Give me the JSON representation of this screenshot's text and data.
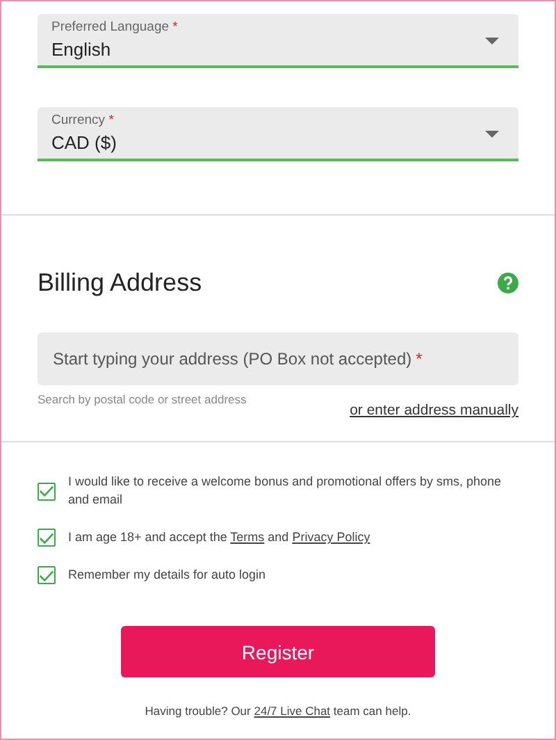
{
  "selects": [
    {
      "label": "Preferred Language",
      "required_mark": "*",
      "value": "English"
    },
    {
      "label": "Currency",
      "required_mark": "*",
      "value": "CAD ($)"
    }
  ],
  "billing": {
    "title": "Billing Address",
    "address_field": {
      "placeholder": "Start typing your address (PO Box not accepted)",
      "required_mark": "*"
    },
    "hint": "Search by postal code or street address",
    "manual_link": "or enter address manually"
  },
  "checkboxes": [
    {
      "checked": true,
      "parts": [
        {
          "kind": "text",
          "text": "I would like to receive a welcome bonus and promotional offers by sms, phone and email"
        }
      ]
    },
    {
      "checked": true,
      "parts": [
        {
          "kind": "text",
          "text": "I am age 18+ and accept the "
        },
        {
          "kind": "link",
          "text": "Terms"
        },
        {
          "kind": "text",
          "text": " and "
        },
        {
          "kind": "link",
          "text": "Privacy Policy"
        }
      ]
    },
    {
      "checked": true,
      "parts": [
        {
          "kind": "text",
          "text": "Remember my details for auto login"
        }
      ]
    }
  ],
  "register_button": "Register",
  "footer": {
    "parts": [
      {
        "kind": "text",
        "text": "Having trouble? Our "
      },
      {
        "kind": "link",
        "text": "24/7 Live Chat"
      },
      {
        "kind": "text",
        "text": " team can help."
      }
    ]
  }
}
